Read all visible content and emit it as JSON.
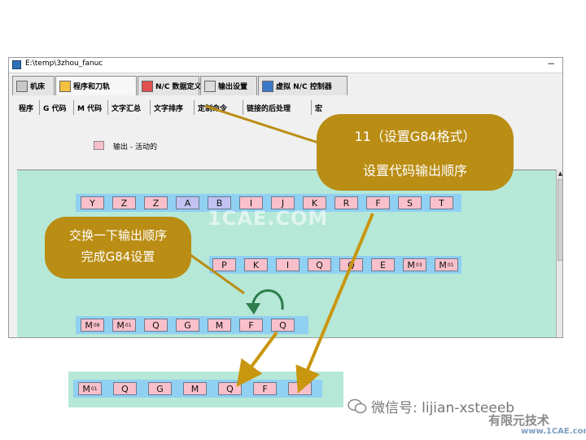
{
  "window": {
    "title": "E:\\temp\\3zhou_fanuc",
    "minimize": "−"
  },
  "main_tabs": [
    {
      "label": "机床",
      "icon": "machine-icon"
    },
    {
      "label": "程序和刀轨",
      "icon": "program-path-icon",
      "active": true
    },
    {
      "label": "N/C 数据定义",
      "icon": "nc-data-icon"
    },
    {
      "label": "输出设置",
      "icon": "output-settings-icon"
    },
    {
      "label": "虚拟 N/C 控制器",
      "icon": "virtual-controller-icon"
    }
  ],
  "sub_tabs": [
    "程序",
    "G 代码",
    "M 代码",
    "文字汇总",
    "文字排序",
    "定制命令",
    "链接的后处理",
    "宏"
  ],
  "legend": {
    "text": "输出 - 活动的",
    "color": "#f9c0cc"
  },
  "rows": {
    "row1": [
      {
        "letter": "Y",
        "state": "pink"
      },
      {
        "letter": "Z",
        "state": "pink"
      },
      {
        "letter": "Z",
        "state": "pink"
      },
      {
        "letter": "A",
        "state": "blue"
      },
      {
        "letter": "B",
        "state": "blue"
      },
      {
        "letter": "I",
        "state": "pink"
      },
      {
        "letter": "J",
        "state": "pink"
      },
      {
        "letter": "K",
        "state": "pink"
      },
      {
        "letter": "R",
        "state": "pink"
      },
      {
        "letter": "F",
        "state": "pink"
      },
      {
        "letter": "S",
        "state": "pink"
      },
      {
        "letter": "T",
        "state": "pink"
      }
    ],
    "row2": [
      {
        "letter": "P",
        "state": "pink"
      },
      {
        "letter": "K",
        "state": "pink"
      },
      {
        "letter": "I",
        "state": "pink"
      },
      {
        "letter": "Q",
        "state": "pink"
      },
      {
        "letter": "Q",
        "state": "pink"
      },
      {
        "letter": "E",
        "state": "pink"
      },
      {
        "letter": "M",
        "sub": "03",
        "state": "pink"
      },
      {
        "letter": "M",
        "sub": "01",
        "state": "pink"
      }
    ],
    "row3": [
      {
        "letter": "M",
        "sub": "08",
        "state": "pink"
      },
      {
        "letter": "M",
        "sub": "01",
        "state": "pink"
      },
      {
        "letter": "Q",
        "state": "pink"
      },
      {
        "letter": "G",
        "state": "pink"
      },
      {
        "letter": "M",
        "state": "pink"
      },
      {
        "letter": "F",
        "state": "pink"
      },
      {
        "letter": "Q",
        "state": "pink"
      }
    ],
    "result": [
      {
        "letter": "M",
        "sub": "01",
        "state": "pink"
      },
      {
        "letter": "Q",
        "state": "pink"
      },
      {
        "letter": "G",
        "state": "pink"
      },
      {
        "letter": "M",
        "state": "pink"
      },
      {
        "letter": "Q",
        "state": "pink"
      },
      {
        "letter": "F",
        "state": "pink"
      },
      {
        "letter": "F",
        "state": "pink"
      }
    ]
  },
  "callouts": {
    "top": {
      "line1": "11（设置G84格式）",
      "line2": "设置代码输出顺序"
    },
    "left": {
      "line1": "交换一下输出顺序",
      "line2": "完成G84设置"
    }
  },
  "watermark": "1CAE.COM",
  "wechat": "微信号: lijian-xsteeeb",
  "logo": {
    "line1": "有限元技术",
    "line2": "www.1CAE.com"
  },
  "colors": {
    "panel": "#b6e8d7",
    "cell_pink": "#f9c0cc",
    "cell_blue": "#c2c2f2",
    "row_background": "#90d0f2",
    "callout": "#ba8d14",
    "arrow": "#c9960f"
  }
}
